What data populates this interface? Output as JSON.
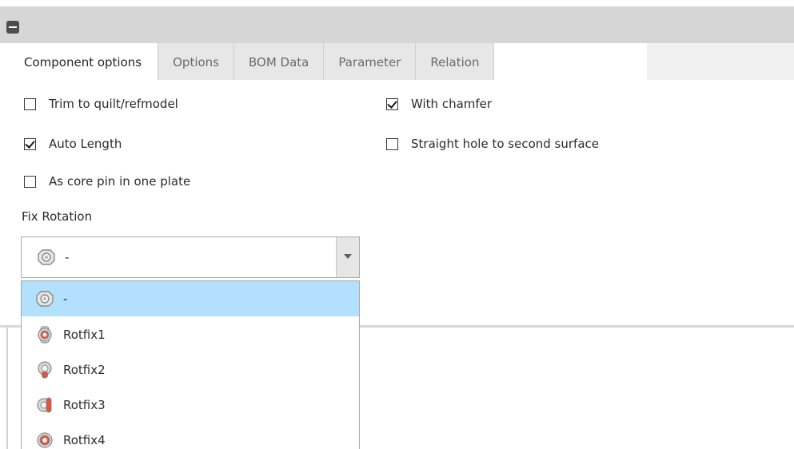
{
  "tabs": [
    {
      "label": "Component options",
      "active": true
    },
    {
      "label": "Options",
      "active": false
    },
    {
      "label": "BOM Data",
      "active": false
    },
    {
      "label": "Parameter",
      "active": false
    },
    {
      "label": "Relation",
      "active": false
    }
  ],
  "options": {
    "trim_to_quilt": {
      "label": "Trim to quilt/refmodel",
      "checked": false
    },
    "auto_length": {
      "label": "Auto Length",
      "checked": true
    },
    "core_pin": {
      "label": "As core pin in one plate",
      "checked": false
    },
    "with_chamfer": {
      "label": "With chamfer",
      "checked": true
    },
    "straight_hole": {
      "label": "Straight hole to second surface",
      "checked": false
    }
  },
  "fix_rotation": {
    "label": "Fix Rotation",
    "selected_value": "-",
    "selected_icon": "rotfix-none-icon",
    "items": [
      {
        "label": "-",
        "icon": "rotfix-none-icon",
        "highlighted": true
      },
      {
        "label": "Rotfix1",
        "icon": "rotfix1-icon",
        "highlighted": false
      },
      {
        "label": "Rotfix2",
        "icon": "rotfix2-icon",
        "highlighted": false
      },
      {
        "label": "Rotfix3",
        "icon": "rotfix3-icon",
        "highlighted": false
      },
      {
        "label": "Rotfix4",
        "icon": "rotfix4-icon",
        "highlighted": false
      }
    ]
  },
  "colors": {
    "highlight": "#b3e0fc",
    "icon_accent": "#e0543c"
  }
}
